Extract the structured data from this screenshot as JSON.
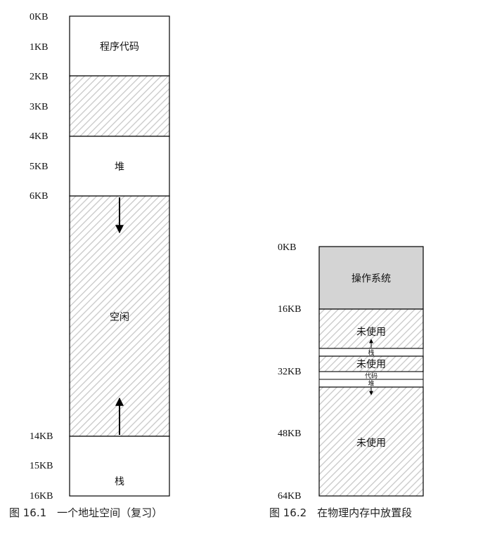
{
  "figure1": {
    "labels": [
      "0KB",
      "1KB",
      "2KB",
      "3KB",
      "4KB",
      "5KB",
      "6KB",
      "14KB",
      "15KB",
      "16KB"
    ],
    "segments": {
      "code": "程序代码",
      "heap": "堆",
      "free": "空闲",
      "stack": "栈"
    },
    "caption": "图 16.1　一个地址空间（复习）"
  },
  "figure2": {
    "labels": [
      "0KB",
      "16KB",
      "32KB",
      "48KB",
      "64KB"
    ],
    "segments": {
      "os": "操作系统",
      "unused1": "未使用",
      "stack": "栈",
      "unused2": "未使用",
      "code": "代码",
      "heap": "堆",
      "unused3": "未使用"
    },
    "caption": "图 16.2　在物理内存中放置段"
  },
  "colors": {
    "hatch": "#c8c8c8",
    "os_fill": "#d4d4d4",
    "border": "#000000"
  }
}
